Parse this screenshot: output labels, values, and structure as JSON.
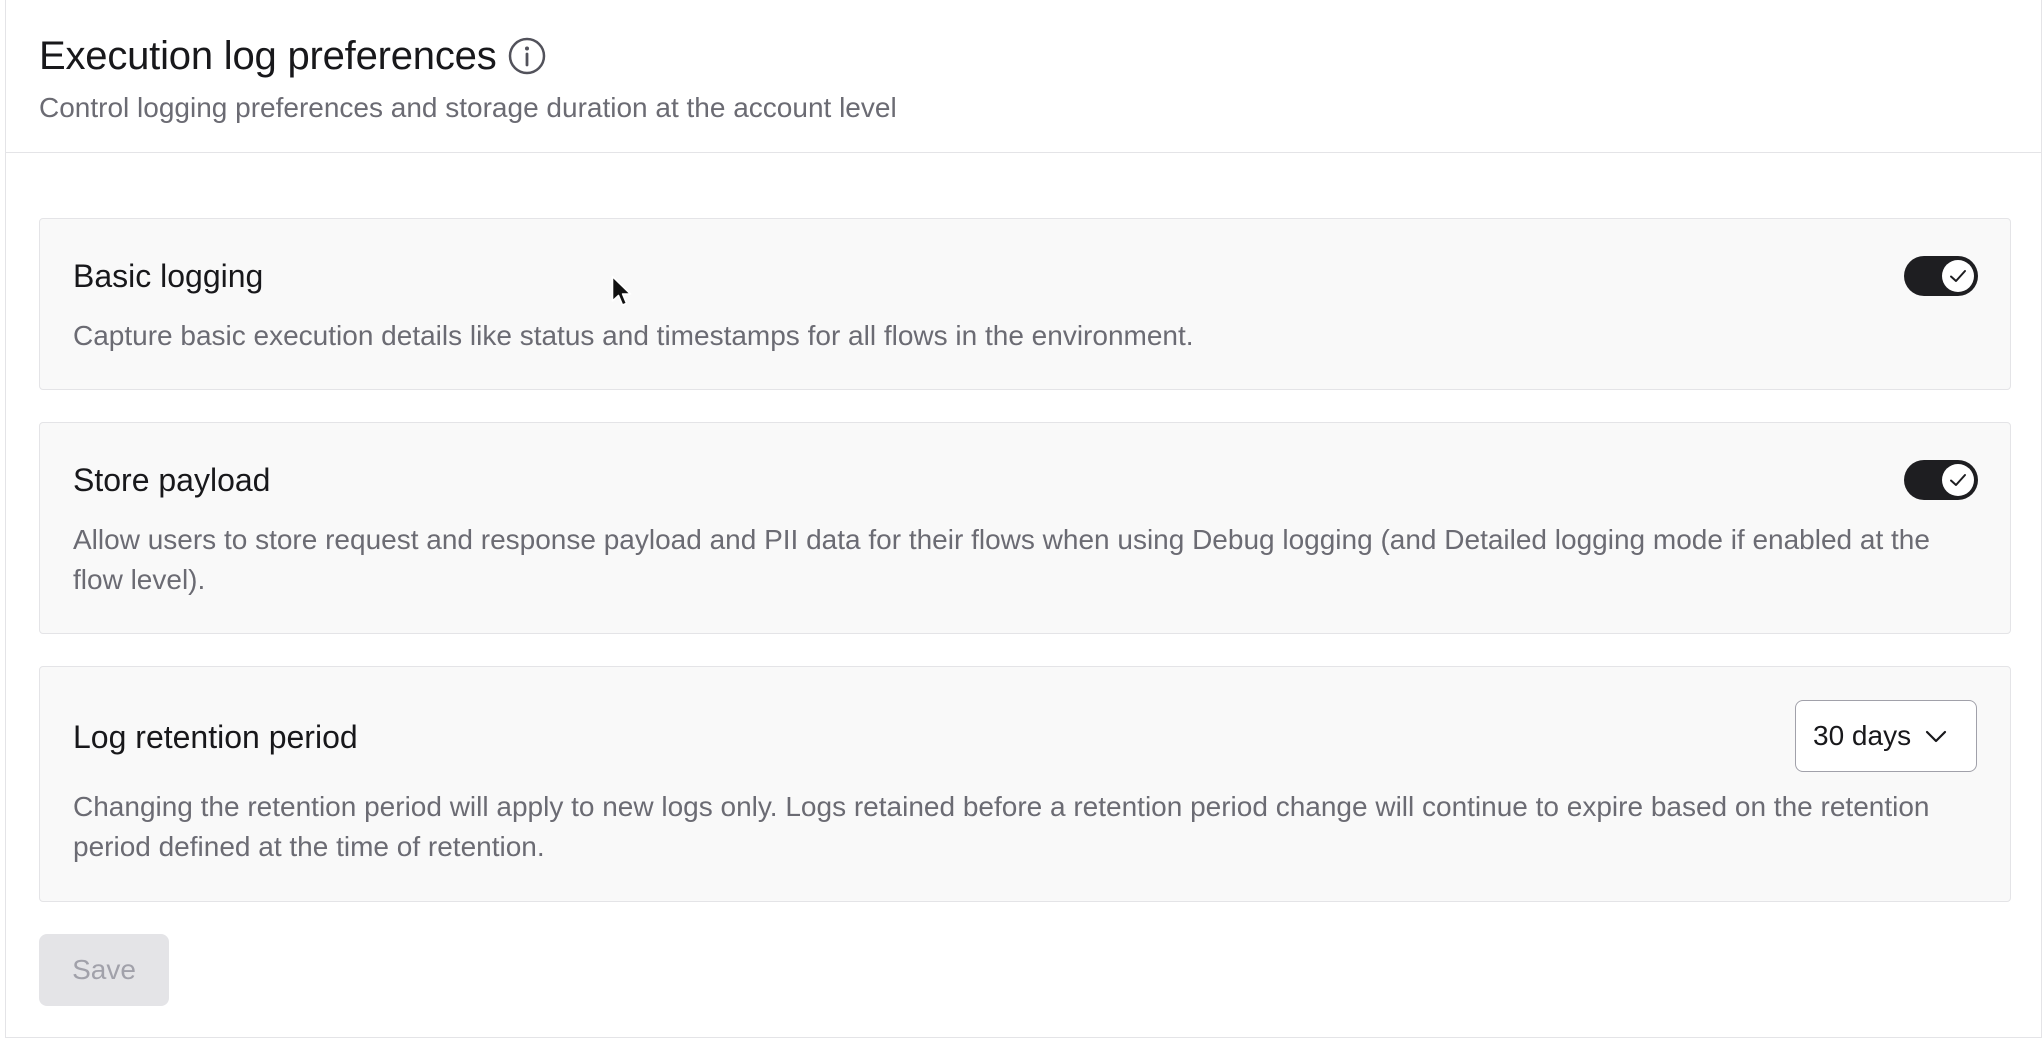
{
  "header": {
    "title": "Execution log preferences",
    "subtitle": "Control logging preferences and storage duration at the account level"
  },
  "settings": {
    "basic_logging": {
      "title": "Basic logging",
      "description": "Capture basic execution details like status and timestamps for all flows in the environment.",
      "enabled": true
    },
    "store_payload": {
      "title": "Store payload",
      "description": "Allow users to store request and response payload and PII data for their flows when using Debug logging (and Detailed logging mode if enabled at the flow level).",
      "enabled": true
    },
    "log_retention": {
      "title": "Log retention period",
      "selected": "30 days",
      "description": "Changing the retention period will apply to new logs only. Logs retained before a retention period change will continue to expire based on the retention period defined at the time of retention."
    }
  },
  "actions": {
    "save_label": "Save",
    "save_disabled": true
  },
  "colors": {
    "toggle_on": "#1e1e21",
    "card_bg": "#f9f9f9",
    "border": "#e4e4e7",
    "muted_text": "#6b6b73"
  },
  "icons": {
    "info": "info-circle-icon",
    "check": "checkmark-icon",
    "chevron": "chevron-down-icon",
    "cursor": "mouse-pointer-icon"
  }
}
